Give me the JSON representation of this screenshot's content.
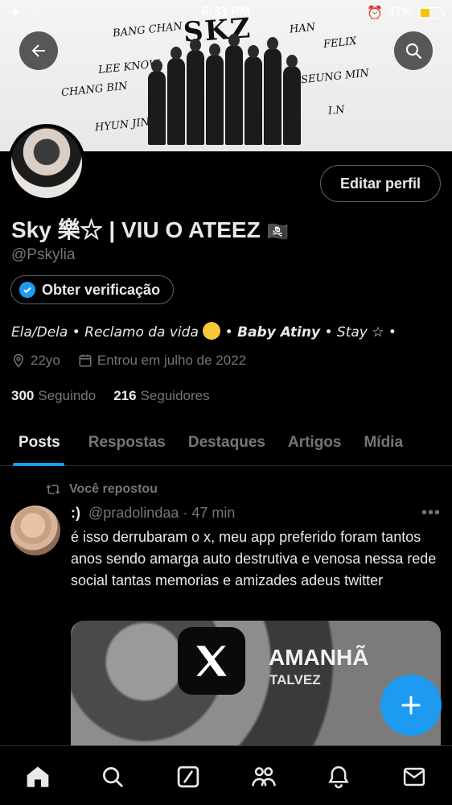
{
  "status_bar": {
    "time": "6:33 PM",
    "battery": "47%",
    "battery_level": 0.47
  },
  "banner": {
    "logo_text": "SKZ",
    "names": [
      "BANG CHAN",
      "LEE KNOW",
      "CHANG BIN",
      "HAN",
      "FELIX",
      "SEUNG MIN",
      "I.N",
      "HYUN JIN"
    ]
  },
  "profile": {
    "name": "Sky 樂☆ | VIU O ATEEZ",
    "flag": "🏴‍☠️",
    "handle": "@Pskylia",
    "verify_label": "Obter verificação",
    "edit_label": "Editar perfil",
    "bio": {
      "part1": "Ela/Dela • Reclamo da vida ",
      "part2": "Baby Atiny",
      "part3": " • Stay ☆ •",
      "separator": " • "
    },
    "age": "22yo",
    "joined": "Entrou em julho de 2022",
    "following_count": "300",
    "following_label": "Seguindo",
    "followers_count": "216",
    "followers_label": "Seguidores"
  },
  "tabs": [
    "Posts",
    "Respostas",
    "Destaques",
    "Artigos",
    "Mídia"
  ],
  "post": {
    "repost_label": "Você repostou",
    "author_name": ":)",
    "author_handle": "@pradolindaa",
    "time": "· 47 min",
    "text": "é isso derrubaram o x, meu app preferido foram tantos anos sendo amarga auto destrutiva e venosa nessa rede social tantas memorias e amizades adeus twitter",
    "media_title": "AMANHÃ",
    "media_sub": "TALVEZ"
  },
  "colors": {
    "accent": "#1d9bf0",
    "muted": "#71767b",
    "text": "#e7e9ea",
    "border": "#2f3336"
  },
  "icons": {
    "bottom_nav": [
      "home-icon",
      "search-icon",
      "grok-icon",
      "communities-icon",
      "notifications-icon",
      "messages-icon"
    ]
  }
}
